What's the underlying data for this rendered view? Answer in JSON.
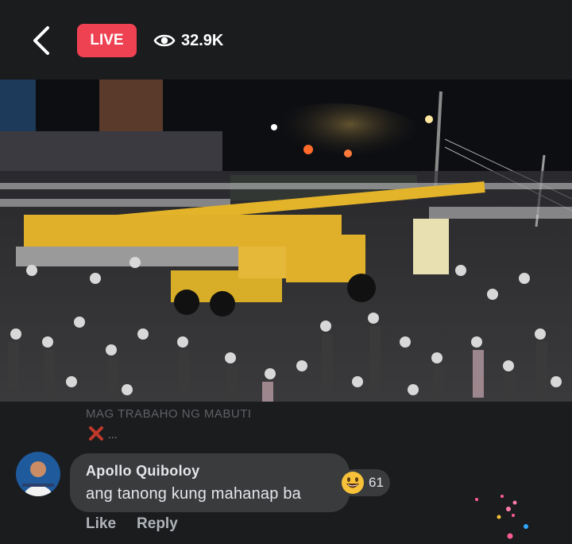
{
  "header": {
    "live_label": "LIVE",
    "viewer_count": "32.9K",
    "back_icon": "chevron-left-icon",
    "viewers_icon": "eye-icon"
  },
  "video": {
    "description_hidden": true
  },
  "previous_comment": {
    "text": "MAG TRABAHO NG MABUTI",
    "ellipsis": "..."
  },
  "comment": {
    "author": "Apollo Quiboloy",
    "text": "ang tanong kung mahanap ba",
    "reaction_icon": "grinning-face-emoji",
    "reaction_count": "61"
  },
  "actions": {
    "like": "Like",
    "reply": "Reply"
  },
  "colors": {
    "background": "#1b1c1e",
    "live_badge": "#ee4152",
    "bubble": "#3a3b3c",
    "action_text": "#b0b3b8"
  }
}
